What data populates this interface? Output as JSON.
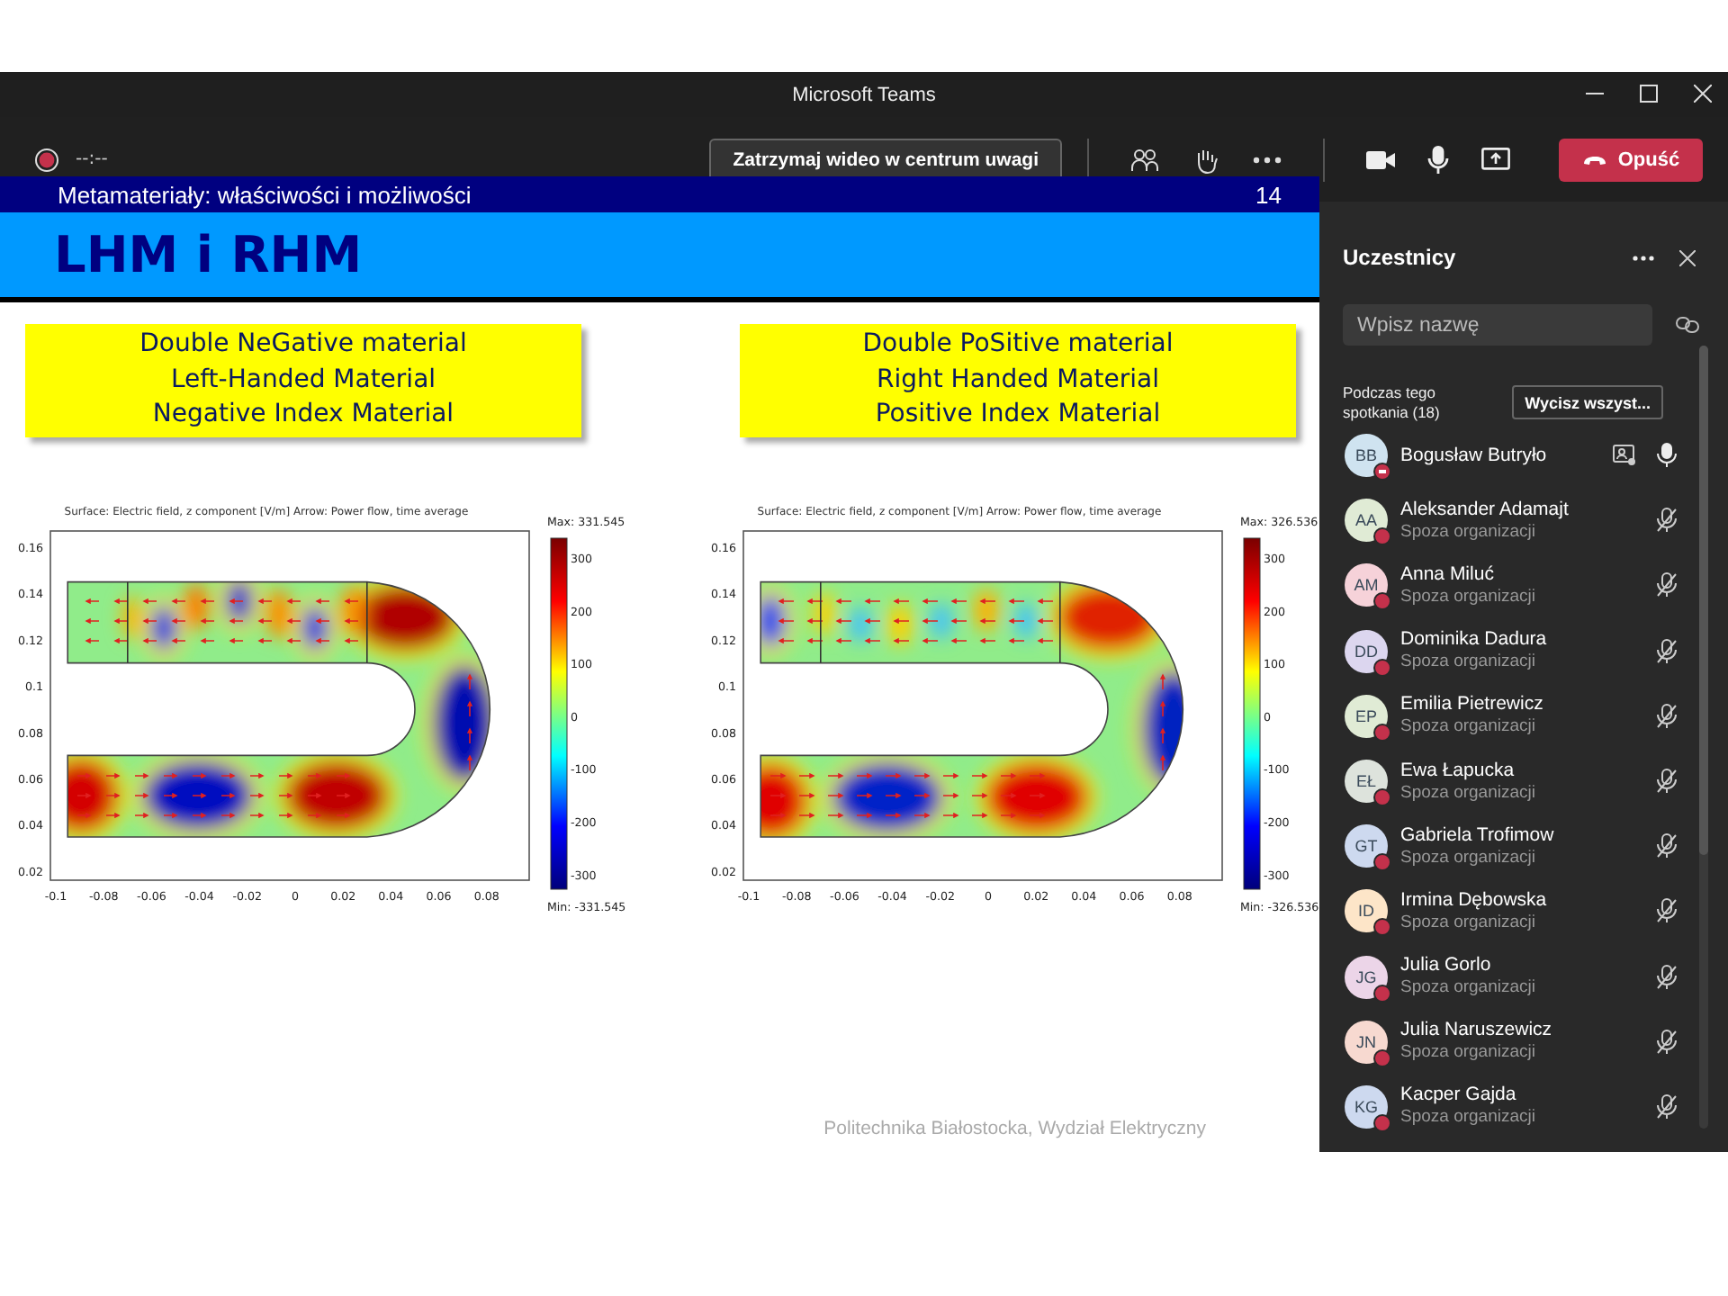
{
  "window": {
    "title": "Microsoft Teams"
  },
  "toolbar": {
    "recording": true,
    "timer": "--:--",
    "spotlight_button": "Zatrzymaj wideo w centrum uwagi",
    "leave_button": "Opuść"
  },
  "slide": {
    "header": "Metamateriały: właściwości i możliwości",
    "page_number": "14",
    "title": "LHM i RHM",
    "boxes": [
      {
        "lines": [
          "Double NeGative material",
          "Left-Handed Material",
          "Negative Index Material"
        ]
      },
      {
        "lines": [
          "Double PoSitive material",
          "Right Handed Material",
          "Positive Index Material"
        ]
      }
    ],
    "plots": [
      {
        "kind": "negative",
        "title": "Surface: Electric field, z component [V/m]   Arrow: Power flow, time average",
        "max": "Max: 331.545",
        "min": "Min: -331.545",
        "yticks": [
          "0.16",
          "0.14",
          "0.12",
          "0.1",
          "0.08",
          "0.06",
          "0.04",
          "0.02"
        ],
        "xticks": [
          "-0.1",
          "-0.08",
          "-0.06",
          "-0.04",
          "-0.02",
          "0",
          "0.02",
          "0.04",
          "0.06",
          "0.08"
        ],
        "colorbar_ticks": [
          "300",
          "200",
          "100",
          "0",
          "-100",
          "-200",
          "-300"
        ]
      },
      {
        "kind": "positive",
        "title": "Surface: Electric field, z component [V/m]   Arrow: Power flow, time average",
        "max": "Max: 326.536",
        "min": "Min: -326.536",
        "yticks": [
          "0.16",
          "0.14",
          "0.12",
          "0.1",
          "0.08",
          "0.06",
          "0.04",
          "0.02"
        ],
        "xticks": [
          "-0.1",
          "-0.08",
          "-0.06",
          "-0.04",
          "-0.02",
          "0",
          "0.02",
          "0.04",
          "0.06",
          "0.08"
        ],
        "colorbar_ticks": [
          "300",
          "200",
          "100",
          "0",
          "-100",
          "-200",
          "-300"
        ]
      }
    ],
    "footer": "Politechnika Białostocka, Wydział Elektryczny"
  },
  "participants": {
    "title": "Uczestnicy",
    "search": {
      "placeholder": "Wpisz nazwę"
    },
    "section": "Podczas tego spotkania (18)",
    "mute_all_button": "Wycisz wszyst...",
    "people": [
      {
        "initials": "BB",
        "name": "Bogusław Butryło",
        "dnd": true,
        "presenter": true,
        "muted": false,
        "color": "#cfe3f0"
      },
      {
        "initials": "AA",
        "name": "Aleksander Adamajt",
        "subtitle": "Spoza organizacji",
        "dnd": false,
        "presenter": false,
        "muted": true,
        "color": "#e0ebd5"
      },
      {
        "initials": "AM",
        "name": "Anna Miluć",
        "subtitle": "Spoza organizacji",
        "dnd": false,
        "presenter": false,
        "muted": true,
        "color": "#f6d2d9"
      },
      {
        "initials": "DD",
        "name": "Dominika Dadura",
        "subtitle": "Spoza organizacji",
        "dnd": false,
        "presenter": false,
        "muted": true,
        "color": "#dcd6ef"
      },
      {
        "initials": "EP",
        "name": "Emilia Pietrewicz",
        "subtitle": "Spoza organizacji",
        "dnd": false,
        "presenter": false,
        "muted": true,
        "color": "#e0ebd5"
      },
      {
        "initials": "EŁ",
        "name": "Ewa Łapucka",
        "subtitle": "Spoza organizacji",
        "dnd": false,
        "presenter": false,
        "muted": true,
        "color": "#dde3dc"
      },
      {
        "initials": "GT",
        "name": "Gabriela Trofimow",
        "subtitle": "Spoza organizacji",
        "dnd": false,
        "presenter": false,
        "muted": true,
        "color": "#cdd9ef"
      },
      {
        "initials": "ID",
        "name": "Irmina Dębowska",
        "subtitle": "Spoza organizacji",
        "dnd": false,
        "presenter": false,
        "muted": true,
        "color": "#fde5c8"
      },
      {
        "initials": "JG",
        "name": "Julia Gorlo",
        "subtitle": "Spoza organizacji",
        "dnd": false,
        "presenter": false,
        "muted": true,
        "color": "#ecd5e8"
      },
      {
        "initials": "JN",
        "name": "Julia Naruszewicz",
        "subtitle": "Spoza organizacji",
        "dnd": false,
        "presenter": false,
        "muted": true,
        "color": "#f7d9d0"
      },
      {
        "initials": "KG",
        "name": "Kacper Gajda",
        "subtitle": "Spoza organizacji",
        "dnd": false,
        "presenter": false,
        "muted": true,
        "color": "#cdd9ef"
      }
    ]
  }
}
